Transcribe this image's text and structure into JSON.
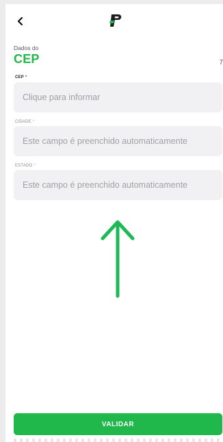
{
  "header": {
    "back_icon": "chevron-left-icon",
    "logo_icon": "brand-logo-icon",
    "logo_text": "",
    "brand_color": "#20b84a"
  },
  "title": {
    "subtitle": "Dados do",
    "main": "CEP",
    "step": "7"
  },
  "fields": [
    {
      "label": "CEP",
      "required_mark": "*",
      "placeholder": "Clique para informar"
    },
    {
      "label": "CIDADE",
      "required_mark": "*",
      "placeholder": "Este campo é preenchido automaticamente"
    },
    {
      "label": "ESTADO",
      "required_mark": "*",
      "placeholder": "Este campo é preenchido automaticamente"
    }
  ],
  "hint_arrow": {
    "icon": "arrow-up-icon",
    "color": "#1db954"
  },
  "actions": {
    "validate_label": "VALIDAR"
  }
}
